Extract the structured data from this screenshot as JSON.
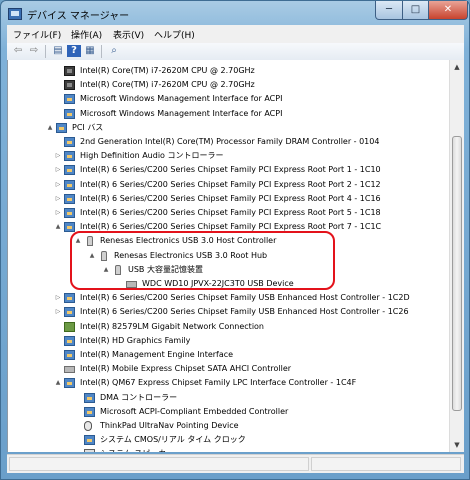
{
  "window": {
    "title": "デバイス マネージャー",
    "minimize_label": "─",
    "maximize_label": "□",
    "close_label": "✕"
  },
  "menu": [
    {
      "label": "ファイル(F)"
    },
    {
      "label": "操作(A)"
    },
    {
      "label": "表示(V)"
    },
    {
      "label": "ヘルプ(H)"
    }
  ],
  "toolbar": {
    "back_glyph": "⇦",
    "forward_glyph": "⇨",
    "properties_glyph": "▤",
    "help_glyph": "?",
    "view_glyph": "▦",
    "scan_glyph": "⌕"
  },
  "tree": [
    {
      "text": "Intel(R) Core(TM) i7-2620M CPU @ 2.70GHz",
      "icon": "cpu-icon",
      "toggle": ""
    },
    {
      "text": "Intel(R) Core(TM) i7-2620M CPU @ 2.70GHz",
      "icon": "cpu-icon",
      "toggle": ""
    },
    {
      "text": "Microsoft Windows Management Interface for ACPI",
      "icon": "board-icon",
      "toggle": ""
    },
    {
      "text": "Microsoft Windows Management Interface for ACPI",
      "icon": "board-icon",
      "toggle": ""
    },
    {
      "text": "PCI バス",
      "icon": "board-icon",
      "toggle": "▲"
    },
    {
      "text": "2nd Generation Intel(R) Core(TM) Processor Family DRAM Controller - 0104",
      "icon": "board-icon",
      "toggle": ""
    },
    {
      "text": "High Definition Audio コントローラー",
      "icon": "board-icon",
      "toggle": "▷"
    },
    {
      "text": "Intel(R) 6 Series/C200 Series Chipset Family PCI Express Root Port 1 - 1C10",
      "icon": "board-icon",
      "toggle": "▷"
    },
    {
      "text": "Intel(R) 6 Series/C200 Series Chipset Family PCI Express Root Port 2 - 1C12",
      "icon": "board-icon",
      "toggle": "▷"
    },
    {
      "text": "Intel(R) 6 Series/C200 Series Chipset Family PCI Express Root Port 4 - 1C16",
      "icon": "board-icon",
      "toggle": "▷"
    },
    {
      "text": "Intel(R) 6 Series/C200 Series Chipset Family PCI Express Root Port 5 - 1C18",
      "icon": "board-icon",
      "toggle": "▷"
    },
    {
      "text": "Intel(R) 6 Series/C200 Series Chipset Family PCI Express Root Port 7 - 1C1C",
      "icon": "board-icon",
      "toggle": "▲"
    },
    {
      "text": "Renesas Electronics USB 3.0 Host Controller",
      "icon": "usb-icon",
      "toggle": "▲"
    },
    {
      "text": "Renesas Electronics USB 3.0 Root Hub",
      "icon": "usb-icon",
      "toggle": "▲"
    },
    {
      "text": "USB 大容量記憶装置",
      "icon": "usb-icon",
      "toggle": "▲"
    },
    {
      "text": "WDC WD10 JPVX-22JC3T0 USB Device",
      "icon": "drive-icon",
      "toggle": ""
    },
    {
      "text": "Intel(R) 6 Series/C200 Series Chipset Family USB Enhanced Host Controller - 1C2D",
      "icon": "board-icon",
      "toggle": "▷"
    },
    {
      "text": "Intel(R) 6 Series/C200 Series Chipset Family USB Enhanced Host Controller - 1C26",
      "icon": "board-icon",
      "toggle": "▷"
    },
    {
      "text": "Intel(R) 82579LM Gigabit Network Connection",
      "icon": "network-icon",
      "toggle": ""
    },
    {
      "text": "Intel(R) HD Graphics Family",
      "icon": "board-icon",
      "toggle": ""
    },
    {
      "text": "Intel(R) Management Engine Interface",
      "icon": "board-icon",
      "toggle": ""
    },
    {
      "text": "Intel(R) Mobile Express Chipset SATA AHCI Controller",
      "icon": "drive-icon",
      "toggle": ""
    },
    {
      "text": "Intel(R) QM67 Express Chipset Family LPC Interface Controller - 1C4F",
      "icon": "board-icon",
      "toggle": "▲"
    },
    {
      "text": "DMA コントローラー",
      "icon": "board-icon",
      "toggle": ""
    },
    {
      "text": "Microsoft ACPI-Compliant Embedded Controller",
      "icon": "board-icon",
      "toggle": ""
    },
    {
      "text": "ThinkPad UltraNav Pointing Device",
      "icon": "mouse-icon",
      "toggle": ""
    },
    {
      "text": "システム CMOS/リアル タイム クロック",
      "icon": "board-icon",
      "toggle": ""
    },
    {
      "text": "システム スピーカー",
      "icon": "speaker-icon",
      "toggle": ""
    }
  ],
  "scrollbar": {
    "up_glyph": "▲",
    "down_glyph": "▼"
  }
}
